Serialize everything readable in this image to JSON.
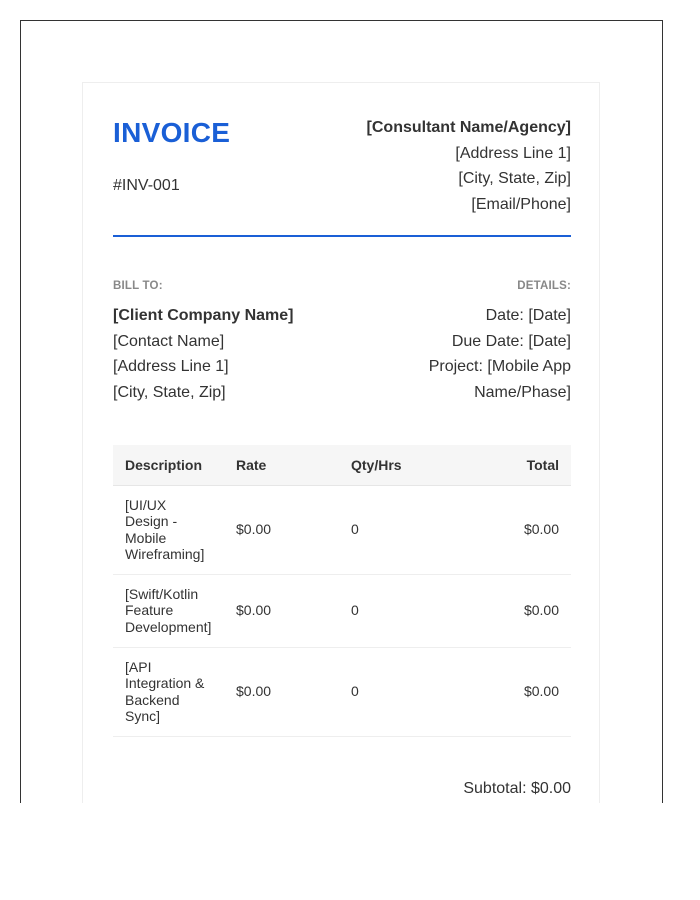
{
  "colors": {
    "accent": "#1a5fd6",
    "text": "#333333",
    "muted_label": "#888888",
    "table_header_bg": "#f6f6f6"
  },
  "invoice": {
    "title": "INVOICE",
    "number": "#INV-001"
  },
  "consultant": {
    "name": "[Consultant Name/Agency]",
    "address_line_1": "[Address Line 1]",
    "city_state_zip": "[City, State, Zip]",
    "email_phone": "[Email/Phone]"
  },
  "bill_to": {
    "label": "BILL TO:",
    "company": "[Client Company Name]",
    "contact": "[Contact Name]",
    "address_line_1": "[Address Line 1]",
    "city_state_zip": "[City, State, Zip]"
  },
  "details": {
    "label": "DETAILS:",
    "date": "Date: [Date]",
    "due_date": "Due Date: [Date]",
    "project": "Project: [Mobile App Name/Phase]"
  },
  "table": {
    "headers": {
      "description": "Description",
      "rate": "Rate",
      "qty": "Qty/Hrs",
      "total": "Total"
    },
    "rows": [
      {
        "description": "[UI/UX Design - Mobile Wireframing]",
        "rate": "$0.00",
        "qty": "0",
        "total": "$0.00"
      },
      {
        "description": "[Swift/Kotlin Feature Development]",
        "rate": "$0.00",
        "qty": "0",
        "total": "$0.00"
      },
      {
        "description": "[API Integration & Backend Sync]",
        "rate": "$0.00",
        "qty": "0",
        "total": "$0.00"
      }
    ]
  },
  "totals": {
    "subtotal": "Subtotal: $0.00"
  }
}
